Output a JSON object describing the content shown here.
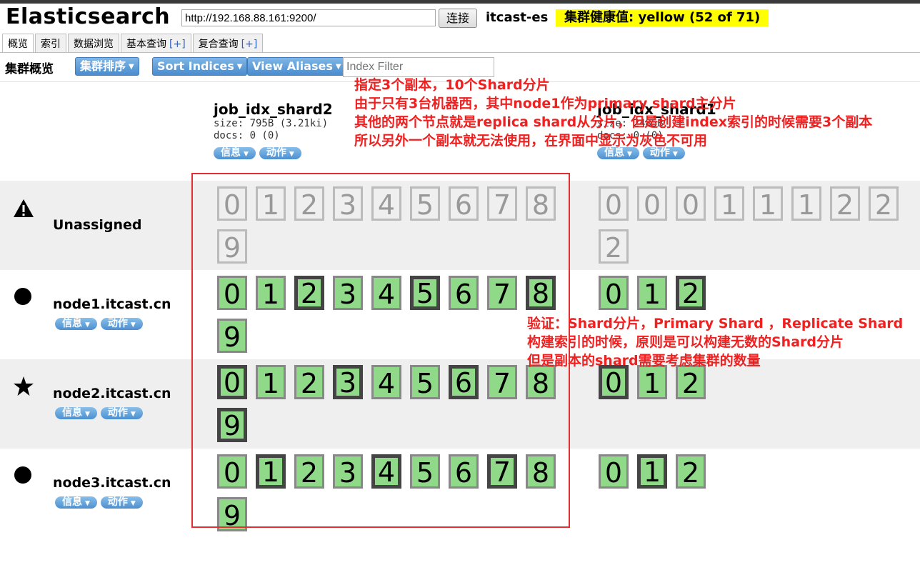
{
  "app": {
    "title": "Elasticsearch",
    "url": "http://192.168.88.161:9200/",
    "connect_label": "连接",
    "cluster_name": "itcast-es",
    "health": "集群健康值: yellow (52 of 71)"
  },
  "tabs": [
    {
      "label": "概览",
      "plus": ""
    },
    {
      "label": "索引",
      "plus": ""
    },
    {
      "label": "数据浏览",
      "plus": ""
    },
    {
      "label": "基本查询",
      "plus": "[+]"
    },
    {
      "label": "复合查询",
      "plus": "[+]"
    }
  ],
  "toolbar": {
    "heading": "集群概览",
    "sort_cluster": "集群排序",
    "sort_indices": "Sort Indices",
    "view_aliases": "View Aliases",
    "filter_placeholder": "Index Filter"
  },
  "indices": [
    {
      "name": "job_idx_shard2",
      "size": "size: 795B (3.21ki)",
      "docs": "docs: 0 (0)",
      "info": "信息",
      "action": "动作"
    },
    {
      "name": "job_idx_shard1",
      "size": "size: 2485B",
      "docs": "docs: 0 (0)",
      "info": "信息",
      "action": "动作"
    }
  ],
  "rows": [
    {
      "name": "Unassigned",
      "icon": "warning-icon",
      "shards_a": [
        [
          "0",
          "unassigned"
        ],
        [
          "1",
          "unassigned"
        ],
        [
          "2",
          "unassigned"
        ],
        [
          "3",
          "unassigned"
        ],
        [
          "4",
          "unassigned"
        ],
        [
          "5",
          "unassigned"
        ],
        [
          "6",
          "unassigned"
        ],
        [
          "7",
          "unassigned"
        ],
        [
          "8",
          "unassigned"
        ],
        [
          "9",
          "unassigned"
        ]
      ],
      "shards_b": [
        [
          "0",
          "unassigned"
        ],
        [
          "0",
          "unassigned"
        ],
        [
          "0",
          "unassigned"
        ],
        [
          "1",
          "unassigned"
        ],
        [
          "1",
          "unassigned"
        ],
        [
          "1",
          "unassigned"
        ],
        [
          "2",
          "unassigned"
        ],
        [
          "2",
          "unassigned"
        ],
        [
          "2",
          "unassigned"
        ]
      ]
    },
    {
      "name": "node1.itcast.cn",
      "icon": "circle-icon",
      "info": "信息",
      "action": "动作",
      "shards_a": [
        [
          "0",
          "replica"
        ],
        [
          "1",
          "replica"
        ],
        [
          "2",
          "primary"
        ],
        [
          "3",
          "replica"
        ],
        [
          "4",
          "replica"
        ],
        [
          "5",
          "primary"
        ],
        [
          "6",
          "replica"
        ],
        [
          "7",
          "replica"
        ],
        [
          "8",
          "primary"
        ],
        [
          "9",
          "replica"
        ]
      ],
      "shards_b": [
        [
          "0",
          "replica"
        ],
        [
          "1",
          "replica"
        ],
        [
          "2",
          "primary"
        ]
      ]
    },
    {
      "name": "node2.itcast.cn",
      "icon": "star-icon",
      "info": "信息",
      "action": "动作",
      "shards_a": [
        [
          "0",
          "primary"
        ],
        [
          "1",
          "replica"
        ],
        [
          "2",
          "replica"
        ],
        [
          "3",
          "primary"
        ],
        [
          "4",
          "replica"
        ],
        [
          "5",
          "replica"
        ],
        [
          "6",
          "primary"
        ],
        [
          "7",
          "replica"
        ],
        [
          "8",
          "replica"
        ],
        [
          "9",
          "primary"
        ]
      ],
      "shards_b": [
        [
          "0",
          "primary"
        ],
        [
          "1",
          "replica"
        ],
        [
          "2",
          "replica"
        ]
      ]
    },
    {
      "name": "node3.itcast.cn",
      "icon": "circle-icon",
      "info": "信息",
      "action": "动作",
      "shards_a": [
        [
          "0",
          "replica"
        ],
        [
          "1",
          "primary"
        ],
        [
          "2",
          "replica"
        ],
        [
          "3",
          "replica"
        ],
        [
          "4",
          "primary"
        ],
        [
          "5",
          "replica"
        ],
        [
          "6",
          "replica"
        ],
        [
          "7",
          "primary"
        ],
        [
          "8",
          "replica"
        ],
        [
          "9",
          "replica"
        ]
      ],
      "shards_b": [
        [
          "0",
          "replica"
        ],
        [
          "1",
          "primary"
        ],
        [
          "2",
          "replica"
        ]
      ]
    }
  ],
  "annotations": {
    "top": [
      "指定3个副本，10个Shard分片",
      "由于只有3台机器西，其中node1作为primary shard主分片",
      "其他的两个节点就是replica shard从分片，但是创建index索引的时候需要3个副本",
      "所以另外一个副本就无法使用，在界面中显示为灰色不可用"
    ],
    "middle": [
      "验证：Shard分片，Primary Shard ，Replicate Shard",
      "构建索引的时候，原则是可以构建无数的Shard分片",
      "但是副本的shard需要考虑集群的数量"
    ]
  },
  "colors": {
    "shard_green": "#90d989",
    "highlight_yellow": "#ffff00",
    "annotation_red": "#f02020",
    "button_blue": "#4a8ccd"
  }
}
